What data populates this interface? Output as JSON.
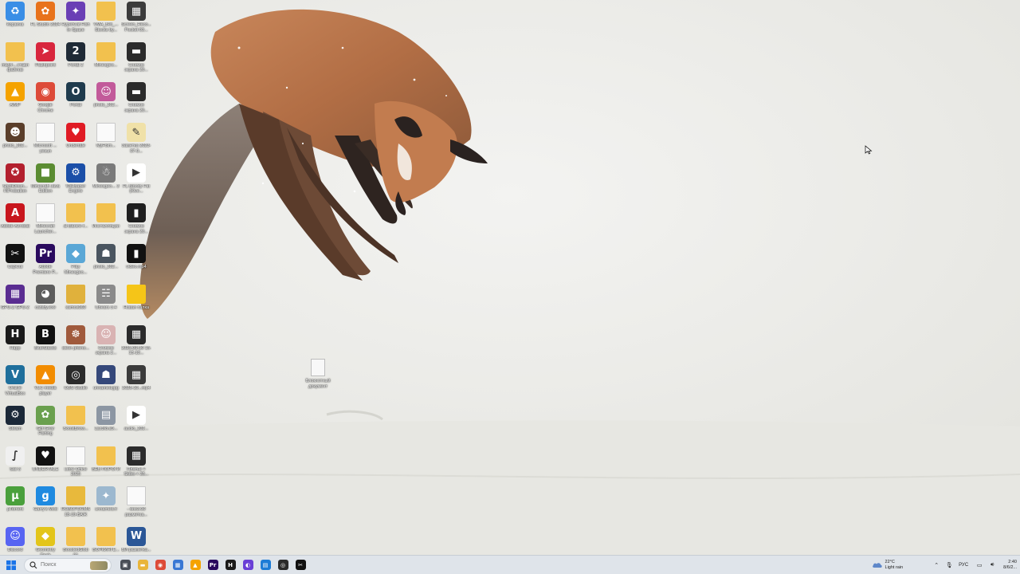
{
  "desktop": {
    "icons": [
      {
        "label": "Корзина",
        "icon": "recycle-bin-icon",
        "color": "#3a8ee6",
        "glyph": "♻"
      },
      {
        "label": "FL Studio 2024",
        "icon": "fl-studio-icon",
        "color": "#e8731c",
        "glyph": "✿"
      },
      {
        "label": "HyperCat Fish In Space",
        "icon": "game-icon",
        "color": "#6a3fb5",
        "glyph": "✦"
      },
      {
        "label": "VMA_Bet_... Stocks by...",
        "icon": "folder-icon",
        "color": "#f2c14e",
        "glyph": ""
      },
      {
        "label": "Screen_Reco... Pocket 03...",
        "icon": "video-file-icon",
        "color": "#3b3b3b",
        "glyph": "▦"
      },
      {
        "label": "mayfl-...ставл файлов",
        "icon": "folder-icon",
        "color": "#f2c14e",
        "glyph": ""
      },
      {
        "label": "Flashpoint",
        "icon": "flashpoint-icon",
        "color": "#d8263d",
        "glyph": "➤"
      },
      {
        "label": "Portal 2",
        "icon": "portal-icon",
        "color": "#1f2a36",
        "glyph": "2"
      },
      {
        "label": "Minesgeo...",
        "icon": "folder-icon",
        "color": "#f2c14e",
        "glyph": ""
      },
      {
        "label": "Снимок экрана 20...",
        "icon": "image-file-icon",
        "color": "#2b2b2b",
        "glyph": "▬"
      },
      {
        "label": "AIMP",
        "icon": "aimp-icon",
        "color": "#f5a300",
        "glyph": "▲"
      },
      {
        "label": "Google Chrome",
        "icon": "chrome-icon",
        "color": "#dd4b39",
        "glyph": "◉"
      },
      {
        "label": "Portal",
        "icon": "portal-icon",
        "color": "#1f3b4d",
        "glyph": "O"
      },
      {
        "label": "photo_202...",
        "icon": "image-file-icon",
        "color": "#c25a9a",
        "glyph": "☺"
      },
      {
        "label": "Снимок экрана 20...",
        "icon": "image-file-icon",
        "color": "#2b2b2b",
        "glyph": "▬"
      },
      {
        "label": "photo_202...",
        "icon": "image-file-icon",
        "color": "#5a3e2a",
        "glyph": "☻"
      },
      {
        "label": "Microsoft ... yesun",
        "icon": "document-icon",
        "color": "#ffffff",
        "glyph": ""
      },
      {
        "label": "Undertale",
        "icon": "undertale-icon",
        "color": "#e01b24",
        "glyph": "♥"
      },
      {
        "label": "MyFolm...",
        "icon": "document-icon",
        "color": "#ffffff",
        "glyph": ""
      },
      {
        "label": "Заметка 2023-07-0...",
        "icon": "note-icon",
        "color": "#f0e1a8",
        "glyph": "✎"
      },
      {
        "label": "SpotiDown... HiProbation",
        "icon": "spotidown-icon",
        "color": "#b3202e",
        "glyph": "✪"
      },
      {
        "label": "Minecraft Java Edition",
        "icon": "minecraft-icon",
        "color": "#5b8c32",
        "glyph": "■"
      },
      {
        "label": "Wallpaper Engine",
        "icon": "wallpaper-engine-icon",
        "color": "#1b4fa8",
        "glyph": "⚙"
      },
      {
        "label": "Minesgeo... 3",
        "icon": "image-file-icon",
        "color": "#7a7a7a",
        "glyph": "☃"
      },
      {
        "label": "FL Bloody Fat (Kive...",
        "icon": "media-file-icon",
        "color": "#ffffff",
        "glyph": "▶"
      },
      {
        "label": "Adobe Acrobat",
        "icon": "acrobat-icon",
        "color": "#c8161d",
        "glyph": "A"
      },
      {
        "label": "Minecraft Launcher...",
        "icon": "document-icon",
        "color": "#ffffff",
        "glyph": ""
      },
      {
        "label": "al-Barsre-f...",
        "icon": "folder-icon",
        "color": "#f2c14e",
        "glyph": ""
      },
      {
        "label": "Инсталляции",
        "icon": "folder-icon",
        "color": "#f2c14e",
        "glyph": ""
      },
      {
        "label": "Снимок экрана 20...",
        "icon": "image-file-icon",
        "color": "#1f1f1f",
        "glyph": "▮"
      },
      {
        "label": "CapCut",
        "icon": "capcut-icon",
        "color": "#111111",
        "glyph": "✂"
      },
      {
        "label": "Adobe Premiere P...",
        "icon": "premiere-icon",
        "color": "#2a0a5e",
        "glyph": "Pr"
      },
      {
        "label": "Play Minesgeo...",
        "icon": "game-icon",
        "color": "#5aa7d6",
        "glyph": "◆"
      },
      {
        "label": "photo_202...",
        "icon": "image-file-icon",
        "color": "#4a5560",
        "glyph": "☗"
      },
      {
        "label": "video.mp4",
        "icon": "video-file-icon",
        "color": "#111111",
        "glyph": "▮"
      },
      {
        "label": "GPU-Z GPU-Z",
        "icon": "gpuz-icon",
        "color": "#5a2d91",
        "glyph": "▦"
      },
      {
        "label": "catsby.exe",
        "icon": "cat-app-icon",
        "color": "#5c5c5c",
        "glyph": "◕"
      },
      {
        "label": "samos060",
        "icon": "folder-icon",
        "color": "#e0b13c",
        "glyph": ""
      },
      {
        "label": "Ubears 3.4",
        "icon": "image-file-icon",
        "color": "#8a8a8a",
        "glyph": "☵"
      },
      {
        "label": "Новая папка",
        "icon": "folder-icon",
        "color": "#f5c518",
        "glyph": ""
      },
      {
        "label": "Happ",
        "icon": "happ-icon",
        "color": "#1a1a1a",
        "glyph": "H"
      },
      {
        "label": "BlueStacks",
        "icon": "bluestacks-icon",
        "color": "#111111",
        "glyph": "B"
      },
      {
        "label": "steer-pheno...",
        "icon": "image-file-icon",
        "color": "#a05a3c",
        "glyph": "☸"
      },
      {
        "label": "Снимок экрана 2...",
        "icon": "image-file-icon",
        "color": "#d9b3b3",
        "glyph": "☺"
      },
      {
        "label": "2025-09-30 15-15-10...",
        "icon": "video-file-icon",
        "color": "#2b2b2b",
        "glyph": "▦"
      },
      {
        "label": "Oracle VirtualBox",
        "icon": "virtualbox-icon",
        "color": "#1f6f9c",
        "glyph": "V"
      },
      {
        "label": "VLC media player",
        "icon": "vlc-icon",
        "color": "#f28c00",
        "glyph": "▲"
      },
      {
        "label": "OBS Studio",
        "icon": "obs-icon",
        "color": "#2b2b2b",
        "glyph": "◎"
      },
      {
        "label": "unnamed.jpg",
        "icon": "image-file-icon",
        "color": "#35487a",
        "glyph": "☗"
      },
      {
        "label": "2025-10...mp4",
        "icon": "video-file-icon",
        "color": "#3b3b3b",
        "glyph": "▦"
      },
      {
        "label": "Steam",
        "icon": "steam-icon",
        "color": "#1b2838",
        "glyph": "⚙"
      },
      {
        "label": "Gift Gear Fishing",
        "icon": "game-icon",
        "color": "#6aa04e",
        "glyph": "✿"
      },
      {
        "label": "BoostBrow...",
        "icon": "folder-icon",
        "color": "#f2c14e",
        "glyph": ""
      },
      {
        "label": "1ac3f8.a9...",
        "icon": "image-file-icon",
        "color": "#8c96a3",
        "glyph": "▤"
      },
      {
        "label": "audio_202...",
        "icon": "media-file-icon",
        "color": "#ffffff",
        "glyph": "▶"
      },
      {
        "label": "Sail 3",
        "icon": "sail-icon",
        "color": "#f0f0f0",
        "glyph": "∫"
      },
      {
        "label": "UNDERTALE",
        "icon": "undertale-icon",
        "color": "#111111",
        "glyph": "♥"
      },
      {
        "label": "Libre Office 2025",
        "icon": "document-icon",
        "color": "#ffffff",
        "glyph": ""
      },
      {
        "label": "ВЕБ ПОРОГИ",
        "icon": "folder-icon",
        "color": "#f2c14e",
        "glyph": ""
      },
      {
        "label": "Платье + Skibo + 35...",
        "icon": "video-file-icon",
        "color": "#2b2b2b",
        "glyph": "▦"
      },
      {
        "label": "µTorrent",
        "icon": "utorrent-icon",
        "color": "#4aa03c",
        "glyph": "µ"
      },
      {
        "label": "Garry's Mod",
        "icon": "gmod-icon",
        "color": "#1f8ae0",
        "glyph": "g"
      },
      {
        "label": "ROBOFORMS 18-10-ВАЖ",
        "icon": "folder-icon",
        "color": "#e8b93c",
        "glyph": ""
      },
      {
        "label": "unnamed.rl",
        "icon": "image-file-icon",
        "color": "#9cb8cf",
        "glyph": "✦"
      },
      {
        "label": "- doc3.00 разметка...",
        "icon": "document-icon",
        "color": "#ffffff",
        "glyph": ""
      },
      {
        "label": "Discord",
        "icon": "discord-icon",
        "color": "#5865f2",
        "glyph": "☺"
      },
      {
        "label": "Geometry Dash",
        "icon": "geometry-dash-icon",
        "color": "#e3c51a",
        "glyph": "◆"
      },
      {
        "label": "BoostedGlob 01",
        "icon": "folder-icon",
        "color": "#f2c14e",
        "glyph": ""
      },
      {
        "label": "ВОРКИНГЕ...",
        "icon": "folder-icon",
        "color": "#f2c14e",
        "glyph": ""
      },
      {
        "label": "ВИ разметка...",
        "icon": "word-doc-icon",
        "color": "#2b5797",
        "glyph": "W"
      }
    ],
    "loose_file": {
      "label": "Блокнотный документ",
      "icon": "text-file-icon"
    }
  },
  "taskbar": {
    "search_placeholder": "Поиск",
    "pinned": [
      {
        "name": "task-view-icon",
        "color": "#4a4f57",
        "glyph": "▣"
      },
      {
        "name": "file-explorer-icon",
        "color": "#e9b53b",
        "glyph": "▬"
      },
      {
        "name": "chrome-icon",
        "color": "#dd4b39",
        "glyph": "◉"
      },
      {
        "name": "store-icon",
        "color": "#3a78d4",
        "glyph": "▦"
      },
      {
        "name": "aimp-icon",
        "color": "#f5a300",
        "glyph": "▲"
      },
      {
        "name": "premiere-icon",
        "color": "#2a0a5e",
        "glyph": "Pr"
      },
      {
        "name": "happ-icon",
        "color": "#1a1a1a",
        "glyph": "H"
      },
      {
        "name": "messenger-icon",
        "color": "#6a3fd6",
        "glyph": "◐"
      },
      {
        "name": "app-blue-icon",
        "color": "#1d7cd6",
        "glyph": "▤"
      },
      {
        "name": "obs-icon",
        "color": "#2b2b2b",
        "glyph": "◎"
      },
      {
        "name": "capcut-icon",
        "color": "#111111",
        "glyph": "✂"
      }
    ],
    "weather": {
      "temp": "22°C",
      "condition": "Light rain"
    },
    "language": "РУС",
    "clock": {
      "time": "2:40",
      "date": "8/6/2..."
    }
  }
}
